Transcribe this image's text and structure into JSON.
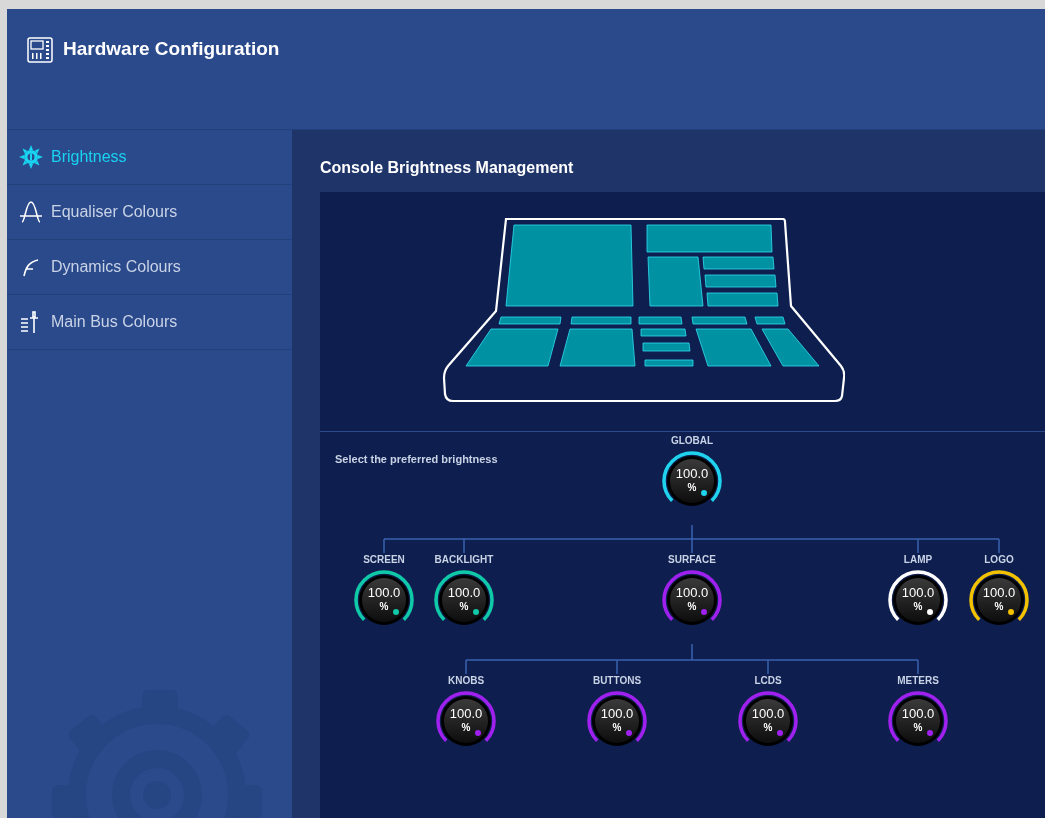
{
  "header": {
    "title": "Hardware Configuration"
  },
  "sidebar": {
    "items": [
      {
        "label": "Brightness",
        "kind": "sun",
        "selected": true
      },
      {
        "label": "Equaliser Colours",
        "kind": "wave",
        "selected": false
      },
      {
        "label": "Dynamics Colours",
        "kind": "curve",
        "selected": false
      },
      {
        "label": "Main Bus Colours",
        "kind": "fader",
        "selected": false
      }
    ]
  },
  "content": {
    "title": "Console Brightness Management",
    "instruction": "Select the preferred brightness",
    "knob_tree": {
      "label": "GLOBAL",
      "value": "100.0",
      "unit": "%",
      "level": 1,
      "color": "#1fd3ee",
      "children": [
        {
          "label": "SCREEN",
          "value": "100.0",
          "unit": "%",
          "level": 1,
          "color": "#10c9a8"
        },
        {
          "label": "BACKLIGHT",
          "value": "100.0",
          "unit": "%",
          "level": 1,
          "color": "#10c9a8"
        },
        {
          "label": "SURFACE",
          "value": "100.0",
          "unit": "%",
          "level": 1,
          "color": "#a020f0",
          "children": [
            {
              "label": "KNOBS",
              "value": "100.0",
              "unit": "%",
              "level": 1,
              "color": "#a020f0"
            },
            {
              "label": "BUTTONS",
              "value": "100.0",
              "unit": "%",
              "level": 1,
              "color": "#a020f0"
            },
            {
              "label": "LCDS",
              "value": "100.0",
              "unit": "%",
              "level": 1,
              "color": "#a020f0"
            },
            {
              "label": "METERS",
              "value": "100.0",
              "unit": "%",
              "level": 1,
              "color": "#a020f0"
            }
          ]
        },
        {
          "label": "LAMP",
          "value": "100.0",
          "unit": "%",
          "level": 1,
          "color": "#ffffff"
        },
        {
          "label": "LOGO",
          "value": "100.0",
          "unit": "%",
          "level": 1,
          "color": "#f2c200"
        }
      ]
    }
  }
}
